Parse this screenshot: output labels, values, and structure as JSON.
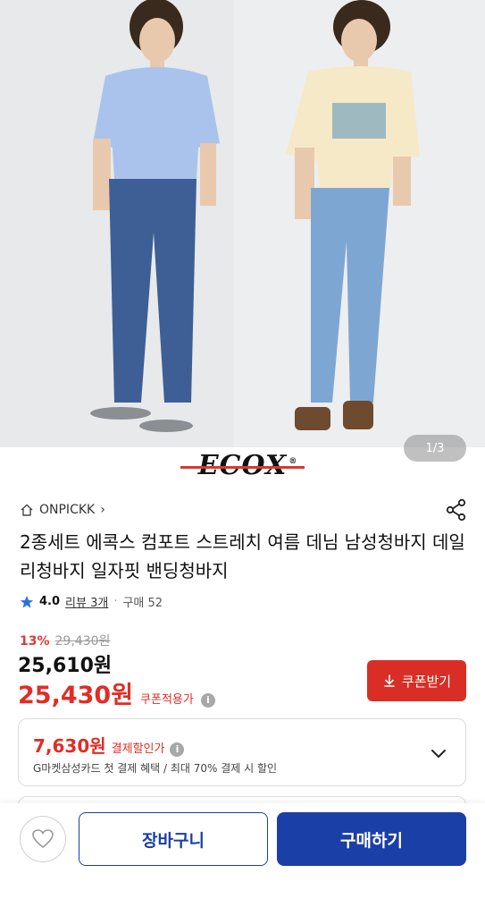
{
  "hero": {
    "pager": "1/3",
    "brand": "ECOX",
    "brand_reg": "®",
    "colors": {
      "background": "#e6e8ea",
      "shirt_left": "#a9c3ec",
      "jeans_left": "#3d5f95",
      "shirt_right": "#f6e9c8",
      "jeans_right": "#7ea6d3"
    }
  },
  "store": {
    "name": "ONPICKK",
    "chevron": "›"
  },
  "product": {
    "title": "2종세트 에콕스 컴포트 스트레치 여름 데님 남성청바지 데일리청바지 일자핏 밴딩청바지"
  },
  "rating": {
    "score": "4.0",
    "review_label": "리뷰 3개",
    "separator": "·",
    "purchase_label": "구매 52"
  },
  "price": {
    "discount_rate": "13%",
    "original": "29,430원",
    "sale": "25,610원",
    "coupon_price": "25,430원",
    "coupon_label": "쿠폰적용가",
    "info_glyph": "i"
  },
  "coupon_button": {
    "label": "쿠폰받기"
  },
  "payment": {
    "amount": "7,630원",
    "label": "결제할인가",
    "detail": "G마켓삼성카드 첫 결제 혜택 / 최대 70% 결제 시 할인"
  },
  "bottom_bar": {
    "cart_label": "장바구니",
    "buy_label": "구매하기"
  },
  "colors": {
    "accent_red": "#e02d26",
    "accent_blue": "#1a3fa6",
    "star": "#2f6fe0"
  }
}
